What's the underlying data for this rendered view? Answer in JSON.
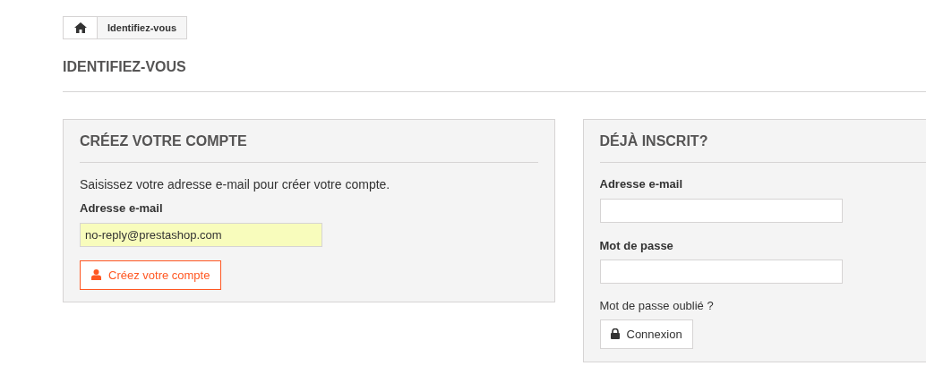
{
  "breadcrumb": {
    "items": [
      {
        "kind": "home"
      },
      {
        "kind": "text",
        "label": "Identifiez-vous"
      }
    ]
  },
  "page_title": "IDENTIFIEZ-VOUS",
  "create_account": {
    "title": "CRÉEZ VOTRE COMPTE",
    "intro": "Saisissez votre adresse e-mail pour créer votre compte.",
    "email_label": "Adresse e-mail",
    "email_value": "no-reply@prestashop.com",
    "button": "Créez votre compte"
  },
  "login": {
    "title": "DÉJÀ INSCRIT?",
    "email_label": "Adresse e-mail",
    "password_label": "Mot de passe",
    "forgot_link": "Mot de passe oublié ?",
    "button": "Connexion"
  }
}
